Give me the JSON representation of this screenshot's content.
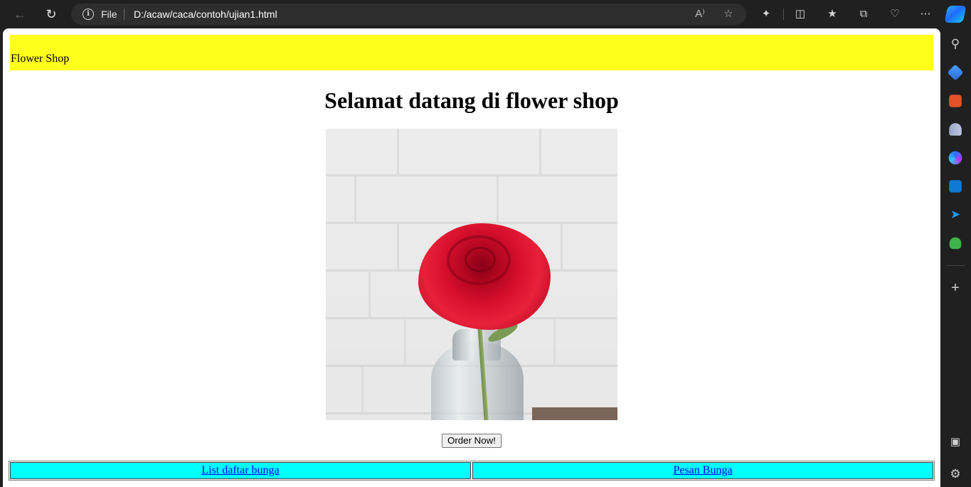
{
  "browser": {
    "address_scheme": "File",
    "address_url": "D:/acaw/caca/contoh/ujian1.html",
    "accent_color": "#1e6bff"
  },
  "page": {
    "header_text": "Flower Shop",
    "header_bg": "#ffff1e",
    "heading": "Selamat datang di flower shop",
    "image_alt": "rose in glass vase",
    "order_button": "Order Now!",
    "nav_links": [
      "List daftar bunga",
      "Pesan Bunga"
    ],
    "nav_bg": "#00ffff"
  },
  "icons": {
    "toolbar": [
      "back-icon",
      "refresh-icon",
      "info-icon",
      "read-aloud-icon",
      "favorite-star-icon",
      "extensions-icon",
      "split-screen-icon",
      "favorites-icon",
      "collections-icon",
      "browser-essentials-icon",
      "more-icon",
      "copilot-icon"
    ],
    "sidebar": [
      "search-icon",
      "shopping-icon",
      "tools-icon",
      "games-icon",
      "microsoft365-icon",
      "outlook-icon",
      "drop-icon",
      "tree-icon",
      "add-icon",
      "screenshot-icon",
      "settings-icon"
    ]
  }
}
